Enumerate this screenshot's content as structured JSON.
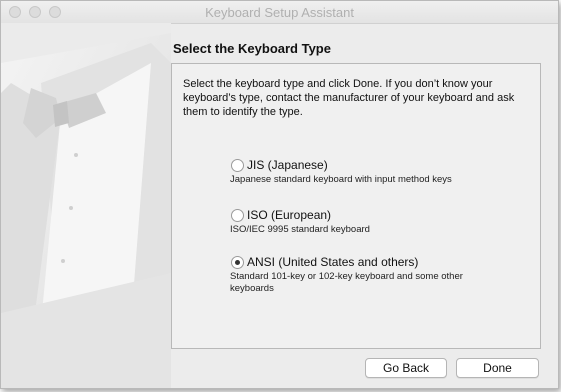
{
  "window": {
    "title": "Keyboard Setup Assistant"
  },
  "heading": "Select the Keyboard Type",
  "instructions": "Select the keyboard type and click Done. If you don’t know your keyboard’s type, contact the manufacturer of your keyboard and ask them to identify the type.",
  "options": [
    {
      "label": "JIS (Japanese)",
      "description": "Japanese standard keyboard with input method keys",
      "selected": false
    },
    {
      "label": "ISO (European)",
      "description": "ISO/IEC 9995 standard keyboard",
      "selected": false
    },
    {
      "label": "ANSI (United States and others)",
      "description": "Standard 101-key or 102-key keyboard and some other keyboards",
      "selected": true
    }
  ],
  "buttons": {
    "back": "Go Back",
    "done": "Done"
  }
}
